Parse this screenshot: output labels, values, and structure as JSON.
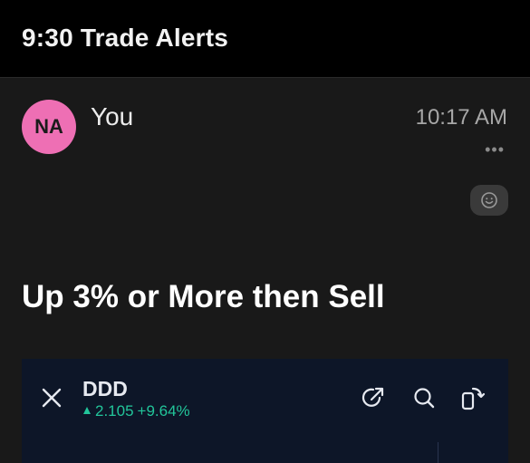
{
  "header": {
    "title": "9:30 Trade Alerts"
  },
  "post": {
    "avatar_initials": "NA",
    "avatar_color": "#ee6fb4",
    "sender": "You",
    "time": "10:17 AM",
    "more_icon": "more-dots-icon",
    "reaction_icon": "smiley-icon",
    "message": "Up 3% or More then Sell"
  },
  "card": {
    "ticker": "DDD",
    "price": "2.105",
    "change": "+9.64%",
    "change_color": "#22c59a",
    "direction_icon": "up-arrow-icon",
    "icons": [
      "close-icon",
      "share-icon",
      "search-icon",
      "rotate-icon"
    ]
  }
}
